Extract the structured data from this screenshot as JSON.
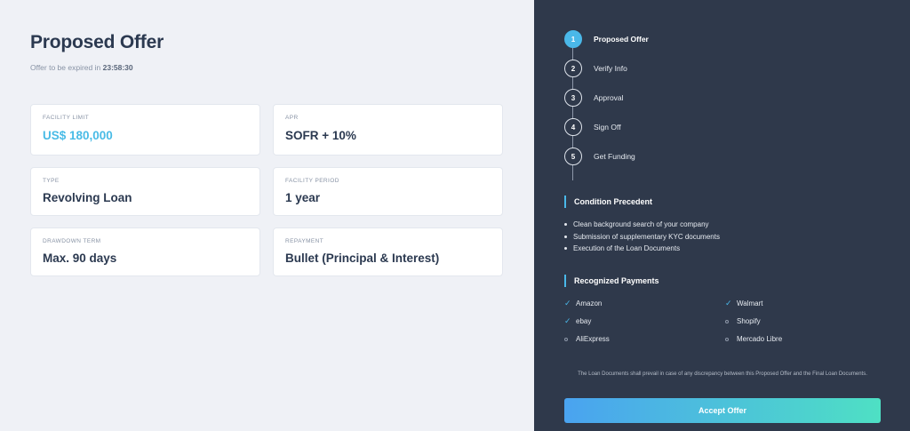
{
  "offer": {
    "title": "Proposed Offer",
    "expiry_prefix": "Offer to be expired in",
    "expiry_time": "23:58:30",
    "cards": [
      {
        "label": "FACILITY LIMIT",
        "value": "US$ 180,000"
      },
      {
        "label": "APR",
        "value": "SOFR + 10%"
      },
      {
        "label": "TYPE",
        "value": "Revolving Loan"
      },
      {
        "label": "FACILITY PERIOD",
        "value": "1 year"
      },
      {
        "label": "DRAWDOWN TERM",
        "value": "Max. 90 days"
      },
      {
        "label": "REPAYMENT",
        "value": "Bullet (Principal & Interest)"
      }
    ]
  },
  "steps": [
    {
      "number": "1",
      "label": "Proposed Offer",
      "active": true
    },
    {
      "number": "2",
      "label": "Verify Info",
      "active": false
    },
    {
      "number": "3",
      "label": "Approval",
      "active": false
    },
    {
      "number": "4",
      "label": "Sign Off",
      "active": false
    },
    {
      "number": "5",
      "label": "Get Funding",
      "active": false
    }
  ],
  "conditions": {
    "title": "Condition Precedent",
    "items": [
      "Clean background search of your company",
      "Submission of supplementary KYC documents",
      "Execution of the Loan Documents"
    ]
  },
  "payments": {
    "title": "Recognized Payments",
    "items": [
      {
        "label": "Amazon",
        "recognized": true,
        "icon": "check-icon"
      },
      {
        "label": "Walmart",
        "recognized": true,
        "icon": "check-icon"
      },
      {
        "label": "ebay",
        "recognized": true,
        "icon": "check-icon"
      },
      {
        "label": "Shopify",
        "recognized": false,
        "icon": "circle-icon"
      },
      {
        "label": "AliExpress",
        "recognized": false,
        "icon": "circle-icon"
      },
      {
        "label": "Mercado Libre",
        "recognized": false,
        "icon": "circle-icon"
      }
    ]
  },
  "disclaimer": "The Loan Documents shall prevail in case of any discrepancy between this Proposed Offer and the Final Loan Documents.",
  "accept_label": "Accept Offer",
  "colors": {
    "accent": "#4ab8e9",
    "panel": "#2f394b",
    "background": "#eff1f6",
    "button_start": "#4aa3f0",
    "button_end": "#4ee0c4"
  }
}
